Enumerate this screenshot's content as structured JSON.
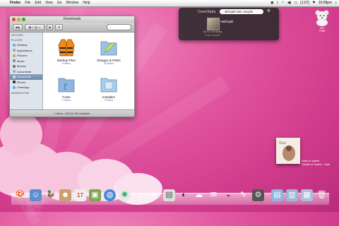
{
  "menubar": {
    "app": "Finder",
    "items": [
      "File",
      "Edit",
      "View",
      "Go",
      "Window",
      "Help"
    ],
    "battery": "(1:07)",
    "clock": "10:08pm"
  },
  "finder": {
    "title": "Downloads",
    "sidebar": {
      "devices_header": "DEVICES",
      "places_header": "PLACES",
      "places": [
        "Desktop",
        "Applications",
        "Pictures",
        "Music",
        "Movies",
        "Documents",
        "Downloads",
        "iPhone",
        "CleanApp"
      ],
      "search_header": "SEARCH FOR"
    },
    "items": [
      {
        "name": "Backup Files",
        "sub": "5 items"
      },
      {
        "name": "Designs & PSDs",
        "sub": "34 items"
      },
      {
        "name": "Fonts",
        "sub": "2 items"
      },
      {
        "name": "Installers",
        "sub": "5 items"
      }
    ],
    "status": "4 items, 159.63 GB available"
  },
  "coversutra": {
    "title": "CoverSutra",
    "search_value": "allelujah kate voegele",
    "song": "Hallelujah",
    "album": "Don't Look Away",
    "artist": "Kate Voegele"
  },
  "drive": {
    "label_1": "WD",
    "label_2": "TIME"
  },
  "desktop_album": {
    "line1": "Stars of Jupiter",
    "line2": "Ghosts of Jupiter - Kate"
  },
  "colors": {
    "accent": "#e2559f",
    "sidebar_selected": "#7890b4",
    "sidebar_bg": "#dde4ec"
  },
  "dock_icons": [
    "mushroom-icon",
    "finder-icon",
    "duck-icon",
    "contacts-icon",
    "ical-icon",
    "photos-icon",
    "globe-icon",
    "safari-icon",
    "itunes-icon",
    "feather-icon",
    "preview-icon",
    "coversutra-icon",
    "ichat-icon",
    "mail-icon",
    "burger-icon",
    "chat-icon",
    "gear-icon",
    "downloads-stack-icon",
    "docs-stack-icon",
    "apps-stack-icon",
    "trash-icon"
  ]
}
